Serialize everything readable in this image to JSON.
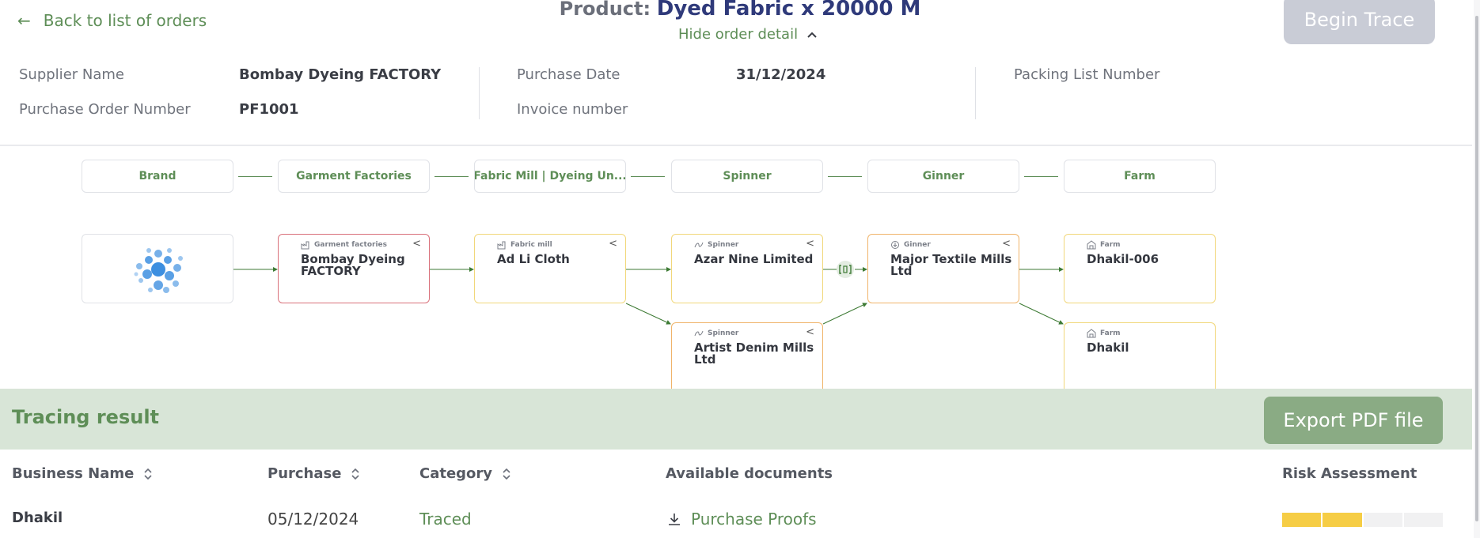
{
  "header": {
    "back_label": "Back to list of orders",
    "product_label": "Product:",
    "product_value": "Dyed Fabric x 20000 M",
    "hide_detail_label": "Hide order detail",
    "begin_trace_label": "Begin Trace"
  },
  "order": {
    "supplier_name_label": "Supplier Name",
    "supplier_name_value": "Bombay Dyeing FACTORY",
    "po_number_label": "Purchase Order Number",
    "po_number_value": "PF1001",
    "purchase_date_label": "Purchase Date",
    "purchase_date_value": "31/12/2024",
    "invoice_label": "Invoice number",
    "packing_list_label": "Packing List Number"
  },
  "flow": {
    "stages": [
      "Brand",
      "Garment Factories",
      "Fabric Mill | Dyeing Un...",
      "Spinner",
      "Ginner",
      "Farm"
    ],
    "nodes": {
      "garment": {
        "tag": "Garment factories",
        "name": "Bombay Dyeing FACTORY"
      },
      "fabric": {
        "tag": "Fabric mill",
        "name": "Ad Li Cloth"
      },
      "spinner1": {
        "tag": "Spinner",
        "name": "Azar Nine Limited"
      },
      "spinner2": {
        "tag": "Spinner",
        "name": "Artist Denim Mills Ltd"
      },
      "ginner": {
        "tag": "Ginner",
        "name": "Major Textile Mills Ltd"
      },
      "farm1": {
        "tag": "Farm",
        "name": "Dhakil-006"
      },
      "farm2": {
        "tag": "Farm",
        "name": "Dhakil"
      }
    }
  },
  "tracing": {
    "title": "Tracing result",
    "export_label": "Export PDF file",
    "columns": {
      "business": "Business Name",
      "purchase": "Purchase",
      "category": "Category",
      "documents": "Available documents",
      "risk": "Risk Assessment"
    },
    "rows": [
      {
        "business": "Dhakil",
        "purchase": "05/12/2024",
        "category": "Traced",
        "document": "Purchase Proofs",
        "risk_level": 2,
        "risk_max": 4
      }
    ]
  },
  "colors": {
    "accent_green": "#5e8e57",
    "product_navy": "#2f3a7a",
    "risk_yellow": "#f6cd45"
  }
}
